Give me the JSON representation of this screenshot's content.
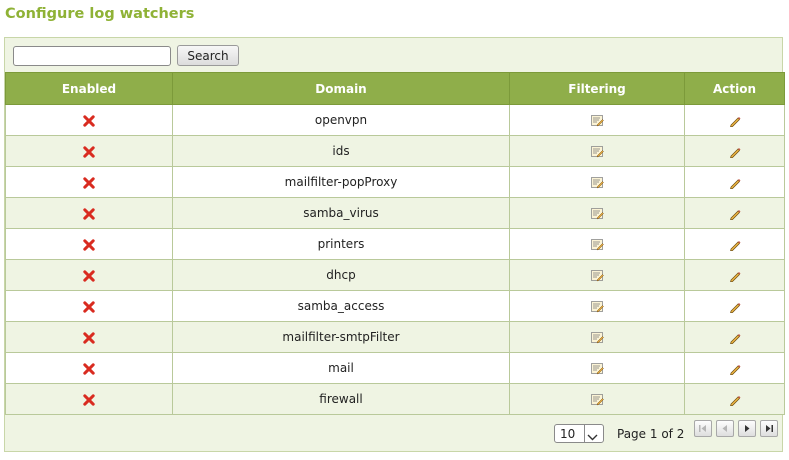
{
  "page": {
    "title": "Configure log watchers"
  },
  "search": {
    "value": "",
    "placeholder": "",
    "button_label": "Search"
  },
  "table": {
    "headers": {
      "enabled": "Enabled",
      "domain": "Domain",
      "filtering": "Filtering",
      "action": "Action"
    },
    "rows": [
      {
        "enabled": false,
        "domain": "openvpn"
      },
      {
        "enabled": false,
        "domain": "ids"
      },
      {
        "enabled": false,
        "domain": "mailfilter-popProxy"
      },
      {
        "enabled": false,
        "domain": "samba_virus"
      },
      {
        "enabled": false,
        "domain": "printers"
      },
      {
        "enabled": false,
        "domain": "dhcp"
      },
      {
        "enabled": false,
        "domain": "samba_access"
      },
      {
        "enabled": false,
        "domain": "mailfilter-smtpFilter"
      },
      {
        "enabled": false,
        "domain": "mail"
      },
      {
        "enabled": false,
        "domain": "firewall"
      }
    ]
  },
  "pager": {
    "page_size": "10",
    "page_info": "Page 1 of 2"
  },
  "icons": {
    "enabled_false": "red-x-icon",
    "filtering": "edit-filter-icon",
    "action": "pencil-icon",
    "first": "first-page-icon",
    "prev": "prev-page-icon",
    "next": "next-page-icon",
    "last": "last-page-icon"
  },
  "colors": {
    "title": "#8fb236",
    "header_bg": "#8fae4a",
    "row_alt": "#eff4e3",
    "disabled_x": "#d92b20"
  }
}
